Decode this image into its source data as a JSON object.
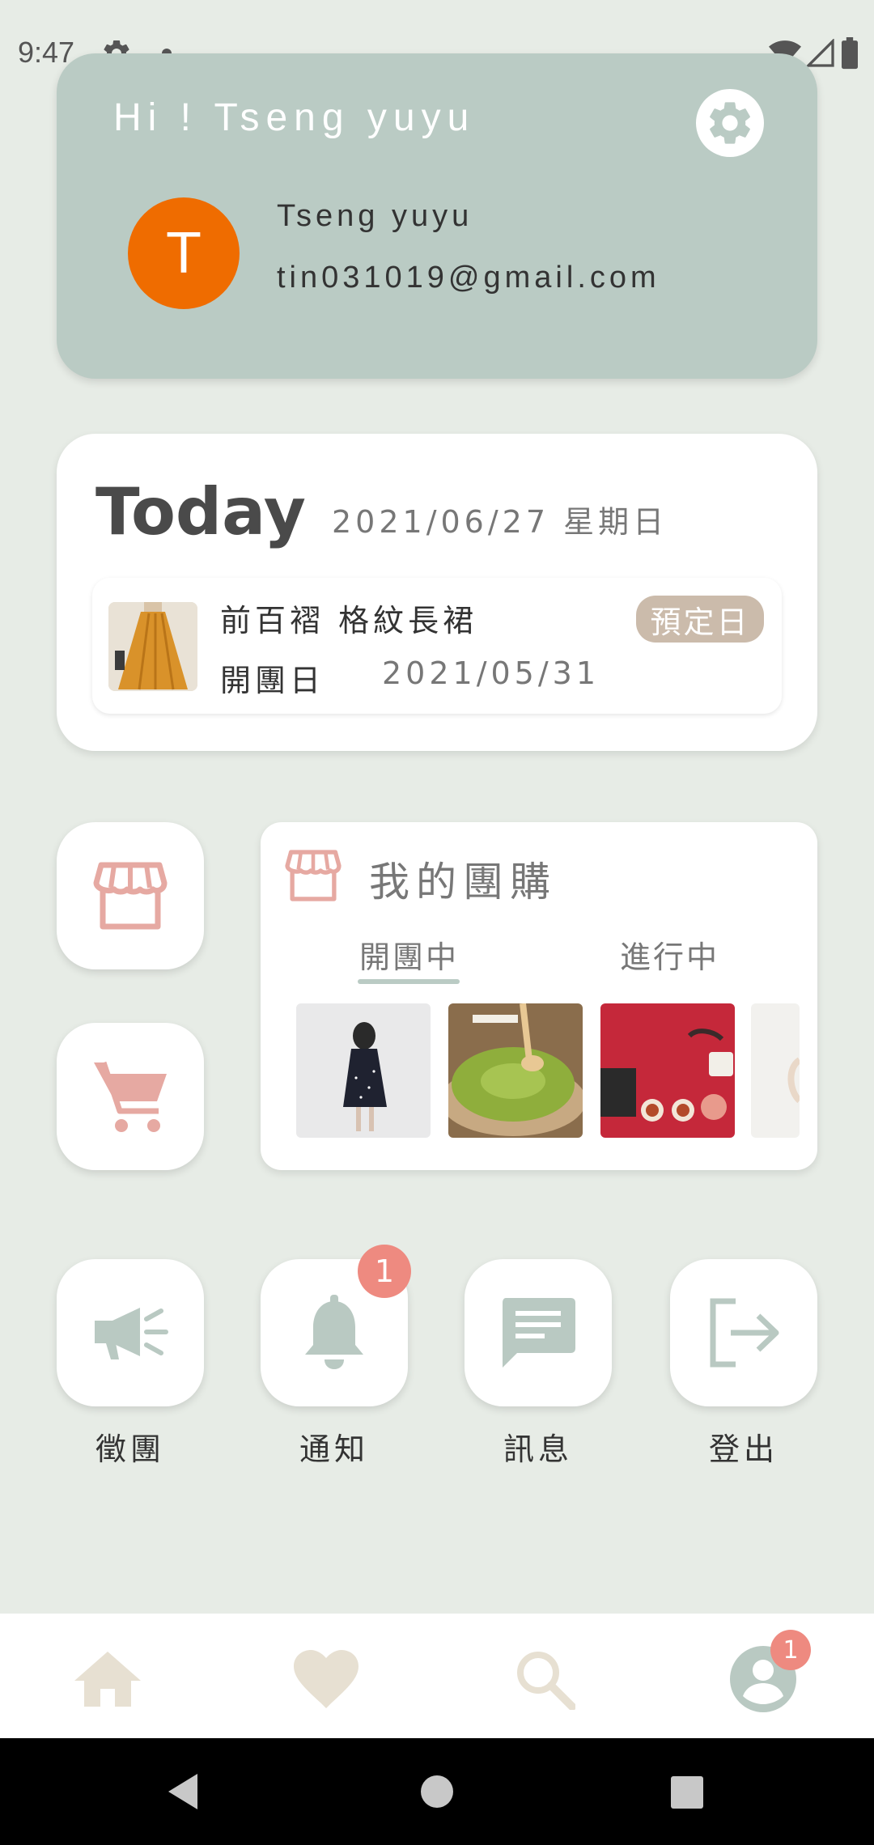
{
  "status_bar": {
    "time": "9:47",
    "icons": [
      "gear-icon",
      "notification-dot-icon",
      "wifi-icon",
      "signal-icon",
      "battery-icon"
    ]
  },
  "profile": {
    "greeting": "Hi ! Tseng yuyu",
    "avatar_letter": "T",
    "name": "Tseng yuyu",
    "email": "tin031019@gmail.com",
    "settings_icon": "gear-icon"
  },
  "today": {
    "title": "Today",
    "date": "2021/06/27 星期日",
    "event": {
      "name": "前百褶 格紋長裙",
      "open_label": "開團日",
      "open_date": "2021/05/31",
      "badge": "預定日"
    }
  },
  "shortcuts": {
    "store_icon": "storefront-icon",
    "cart_icon": "cart-icon"
  },
  "my_groups": {
    "title": "我的團購",
    "tabs": [
      {
        "label": "開團中",
        "active": true
      },
      {
        "label": "進行中",
        "active": false
      }
    ],
    "thumbnails": [
      "dress-photo",
      "matcha-roll-photo",
      "tea-set-photo",
      "partial-photo"
    ]
  },
  "actions": [
    {
      "label": "徵團",
      "icon": "megaphone-icon"
    },
    {
      "label": "通知",
      "icon": "bell-icon",
      "badge": "1"
    },
    {
      "label": "訊息",
      "icon": "message-icon"
    },
    {
      "label": "登出",
      "icon": "logout-icon"
    }
  ],
  "bottom_nav": {
    "items": [
      "home-icon",
      "heart-icon",
      "search-icon",
      "account-icon"
    ],
    "profile_badge": "1"
  },
  "colors": {
    "background": "#e7ece6",
    "profile_card": "#bacbc4",
    "avatar": "#ef6c00",
    "accent_pink": "#e6a9a2",
    "accent_sage": "#b9c9c2",
    "badge": "#ee8a80",
    "nav_beige": "#e7e0d2"
  }
}
